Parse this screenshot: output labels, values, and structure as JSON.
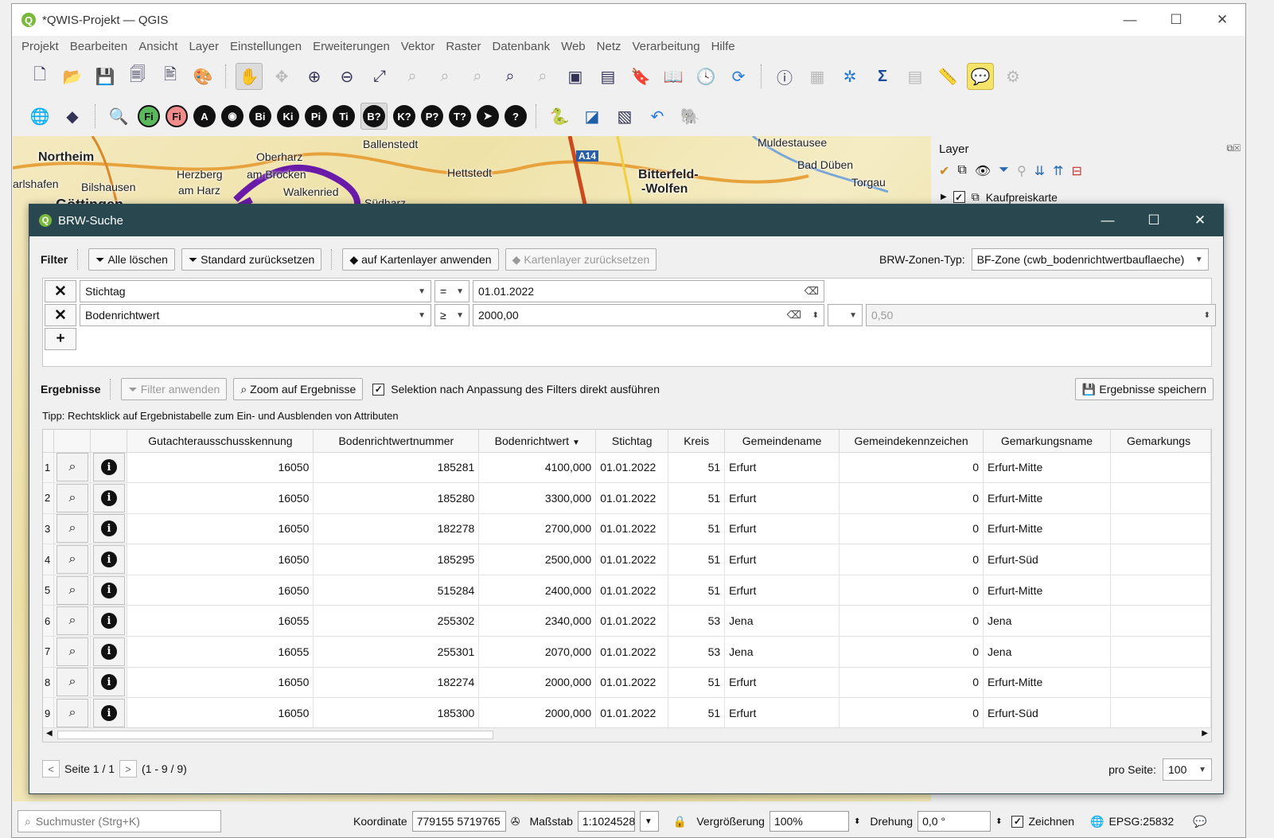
{
  "window": {
    "title": "*QWIS-Projekt — QGIS"
  },
  "menu": [
    "Projekt",
    "Bearbeiten",
    "Ansicht",
    "Layer",
    "Einstellungen",
    "Erweiterungen",
    "Vektor",
    "Raster",
    "Datenbank",
    "Web",
    "Netz",
    "Verarbeitung",
    "Hilfe"
  ],
  "toolbar2": {
    "fi1": "Fi",
    "fi2": "Fi",
    "a": "A",
    "b": "Bi",
    "k": "Ki",
    "p": "Pi",
    "t": "Ti",
    "b2": "B?",
    "k2": "K?",
    "p2": "P?",
    "t2": "T?",
    "help": "?"
  },
  "map_labels": [
    "Northeim",
    "Oberharz",
    "Ballenstedt",
    "Hettstedt",
    "A14",
    "Bitterfeld-",
    "-Wolfen",
    "Muldestausee",
    "Bad Düben",
    "Torgau",
    "Herzberg",
    "am Brocken",
    "arlshafen",
    "Bilshausen",
    "am Harz",
    "Walkenried",
    "Göttingen",
    "Südharz"
  ],
  "layer_panel": {
    "title": "Layer",
    "item": "Kaufpreiskarte"
  },
  "dialog": {
    "title": "BRW-Suche",
    "filter_label": "Filter",
    "btn_clear": "Alle löschen",
    "btn_reset": "Standard zurücksetzen",
    "btn_apply_map": "auf Kartenlayer anwenden",
    "btn_reset_map": "Kartenlayer zurücksetzen",
    "zone_type_label": "BRW-Zonen-Typ:",
    "zone_type_value": "BF-Zone (cwb_bodenrichtwertbauflaeche)",
    "filters": [
      {
        "field": "Stichtag",
        "op": "=",
        "value": "01.01.2022"
      },
      {
        "field": "Bodenrichtwert",
        "op": "≥",
        "value": "2000,00",
        "value2": "0,50"
      }
    ],
    "add_filter": "+",
    "results_label": "Ergebnisse",
    "btn_filter_apply": "Filter anwenden",
    "btn_zoom": "Zoom auf Ergebnisse",
    "chk_selection": "Selektion nach Anpassung des Filters direkt ausführen",
    "btn_save": "Ergebnisse speichern",
    "tip": "Tipp: Rechtsklick auf Ergebnistabelle zum Ein- und Ausblenden von Attributen",
    "columns": [
      "Gutachterausschusskennung",
      "Bodenrichtwertnummer",
      "Bodenrichtwert",
      "Stichtag",
      "Kreis",
      "Gemeindename",
      "Gemeindekennzeichen",
      "Gemarkungsname",
      "Gemarkungs"
    ],
    "rows": [
      [
        "1",
        "16050",
        "185281",
        "4100,000",
        "01.01.2022",
        "51",
        "Erfurt",
        "0",
        "Erfurt-Mitte"
      ],
      [
        "2",
        "16050",
        "185280",
        "3300,000",
        "01.01.2022",
        "51",
        "Erfurt",
        "0",
        "Erfurt-Mitte"
      ],
      [
        "3",
        "16050",
        "182278",
        "2700,000",
        "01.01.2022",
        "51",
        "Erfurt",
        "0",
        "Erfurt-Mitte"
      ],
      [
        "4",
        "16050",
        "185295",
        "2500,000",
        "01.01.2022",
        "51",
        "Erfurt",
        "0",
        "Erfurt-Süd"
      ],
      [
        "5",
        "16050",
        "515284",
        "2400,000",
        "01.01.2022",
        "51",
        "Erfurt",
        "0",
        "Erfurt-Mitte"
      ],
      [
        "6",
        "16055",
        "255302",
        "2340,000",
        "01.01.2022",
        "53",
        "Jena",
        "0",
        "Jena"
      ],
      [
        "7",
        "16055",
        "255301",
        "2070,000",
        "01.01.2022",
        "53",
        "Jena",
        "0",
        "Jena"
      ],
      [
        "8",
        "16050",
        "182274",
        "2000,000",
        "01.01.2022",
        "51",
        "Erfurt",
        "0",
        "Erfurt-Mitte"
      ],
      [
        "9",
        "16050",
        "185300",
        "2000,000",
        "01.01.2022",
        "51",
        "Erfurt",
        "0",
        "Erfurt-Süd"
      ]
    ],
    "page_text": "Seite 1 / 1",
    "range_text": "(1 - 9 / 9)",
    "per_page_label": "pro Seite:",
    "per_page_value": "100"
  },
  "status": {
    "search_placeholder": "Suchmuster (Strg+K)",
    "coord_label": "Koordinate",
    "coord_value": "779155 5719765",
    "scale_label": "Maßstab",
    "scale_value": "1:1024528",
    "zoom_label": "Vergrößerung",
    "zoom_value": "100%",
    "rotation_label": "Drehung",
    "rotation_value": "0,0 °",
    "render_label": "Zeichnen",
    "crs": "EPSG:25832"
  }
}
